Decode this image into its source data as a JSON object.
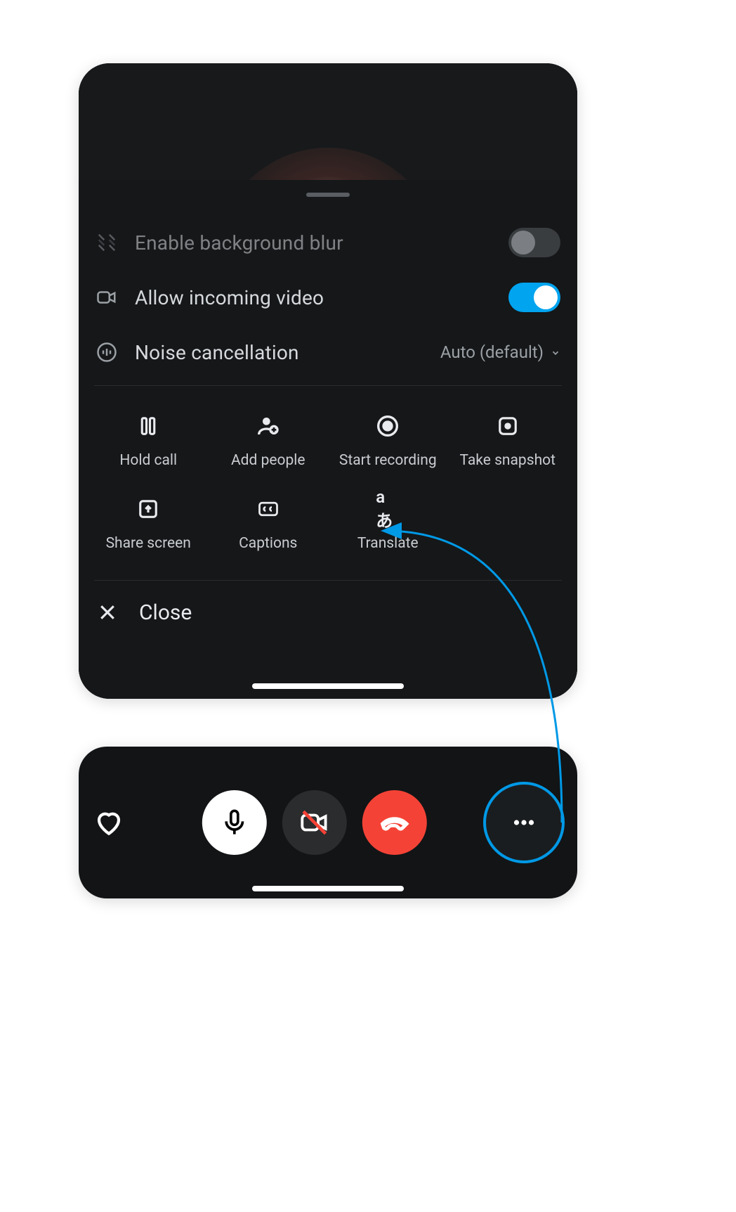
{
  "sheet": {
    "rows": {
      "blur": {
        "label": "Enable background blur",
        "toggled": false,
        "disabled": true
      },
      "video": {
        "label": "Allow incoming video",
        "toggled": true
      },
      "noise": {
        "label": "Noise cancellation",
        "value": "Auto (default)"
      }
    },
    "actions": {
      "hold": {
        "label": "Hold call"
      },
      "add": {
        "label": "Add people"
      },
      "record": {
        "label": "Start recording"
      },
      "snapshot": {
        "label": "Take snapshot"
      },
      "share": {
        "label": "Share screen"
      },
      "captions": {
        "label": "Captions"
      },
      "translate": {
        "label": "Translate"
      }
    },
    "close": {
      "label": "Close"
    }
  },
  "callbar": {
    "react_label": "React",
    "mic_label": "Microphone",
    "camera_label": "Camera off",
    "end_label": "End call",
    "more_label": "More"
  }
}
